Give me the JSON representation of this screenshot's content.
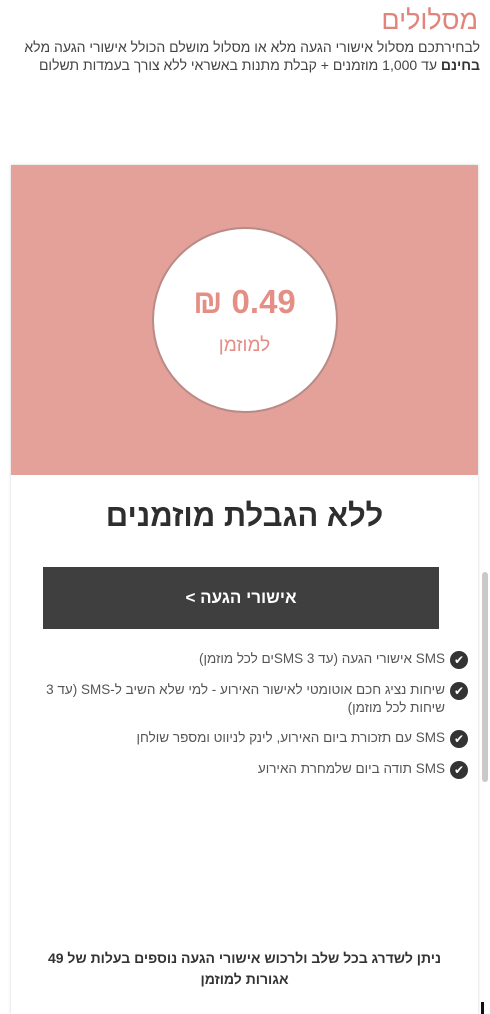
{
  "section": {
    "title": "מסלולים",
    "intro_before": "לבחירתכם מסלול אישורי הגעה מלא או מסלול מושלם הכולל אישורי הגעה מלא ",
    "intro_bold": "בחינם",
    "intro_after": " עד 1,000 מוזמנים + קבלת מתנות באשראי ללא צורך בעמדות תשלום"
  },
  "plan": {
    "price": "0.49 ₪",
    "price_unit": "למוזמן",
    "title": "ללא הגבלת מוזמנים",
    "cta_label": "אישורי הגעה >",
    "features": [
      "SMS אישורי הגעה (עד 3 SMSים לכל מוזמן)",
      "שיחות נציג חכם אוטומטי לאישור האירוע - למי שלא השיב ל-SMS (עד 3 שיחות לכל מוזמן)",
      "SMS עם תזכורת ביום האירוע, לינק לניווט ומספר שולחן",
      "SMS תודה ביום שלמחרת האירוע"
    ],
    "footer_note": "ניתן לשדרג בכל שלב ולרכוש אישורי הגעה נוספים בעלות של 49 אגורות למוזמן"
  },
  "icons": {
    "feature_icon": "check-circle-icon"
  },
  "colors": {
    "accent": "#e2847c",
    "card_header": "#e3a19a",
    "cta_bg": "#3f3f3f"
  }
}
